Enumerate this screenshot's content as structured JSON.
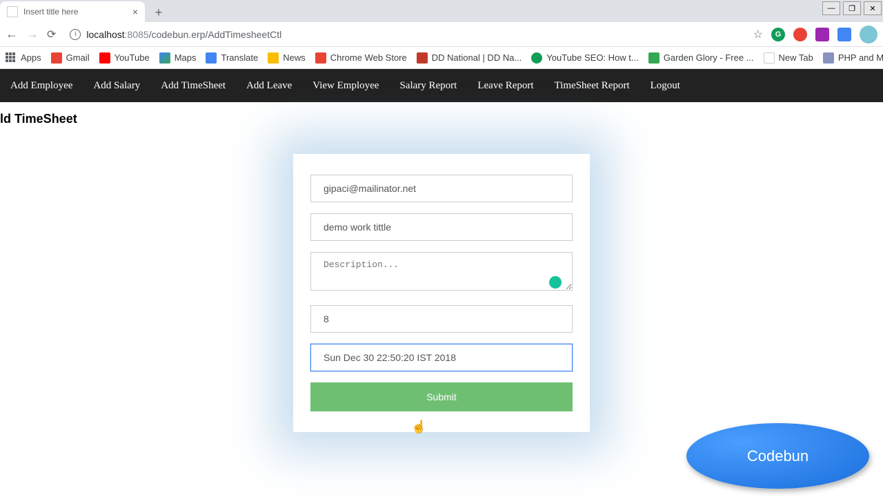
{
  "browser": {
    "tab_title": "Insert title here",
    "url_host": "localhost",
    "url_port": ":8085",
    "url_path": "/codebun.erp/AddTimesheetCtl"
  },
  "bookmarks": [
    {
      "label": "Apps"
    },
    {
      "label": "Gmail"
    },
    {
      "label": "YouTube"
    },
    {
      "label": "Maps"
    },
    {
      "label": "Translate"
    },
    {
      "label": "News"
    },
    {
      "label": "Chrome Web Store"
    },
    {
      "label": "DD National | DD Na..."
    },
    {
      "label": "YouTube SEO: How t..."
    },
    {
      "label": "Garden Glory - Free ..."
    },
    {
      "label": "New Tab"
    },
    {
      "label": "PHP and MySQL Pro..."
    }
  ],
  "nav": {
    "items": [
      "Add Employee",
      "Add Salary",
      "Add TimeSheet",
      "Add Leave",
      "View Employee",
      "Salary Report",
      "Leave Report",
      "TimeSheet Report",
      "Logout"
    ]
  },
  "page": {
    "heading": "ld TimeSheet"
  },
  "form": {
    "email": "gipaci@mailinator.net",
    "title": "demo work tittle",
    "description_placeholder": "Description...",
    "hours": "8",
    "date": "Sun Dec 30 22:50:20 IST 2018",
    "submit_label": "Submit"
  },
  "watermark": {
    "text": "Codebun"
  }
}
